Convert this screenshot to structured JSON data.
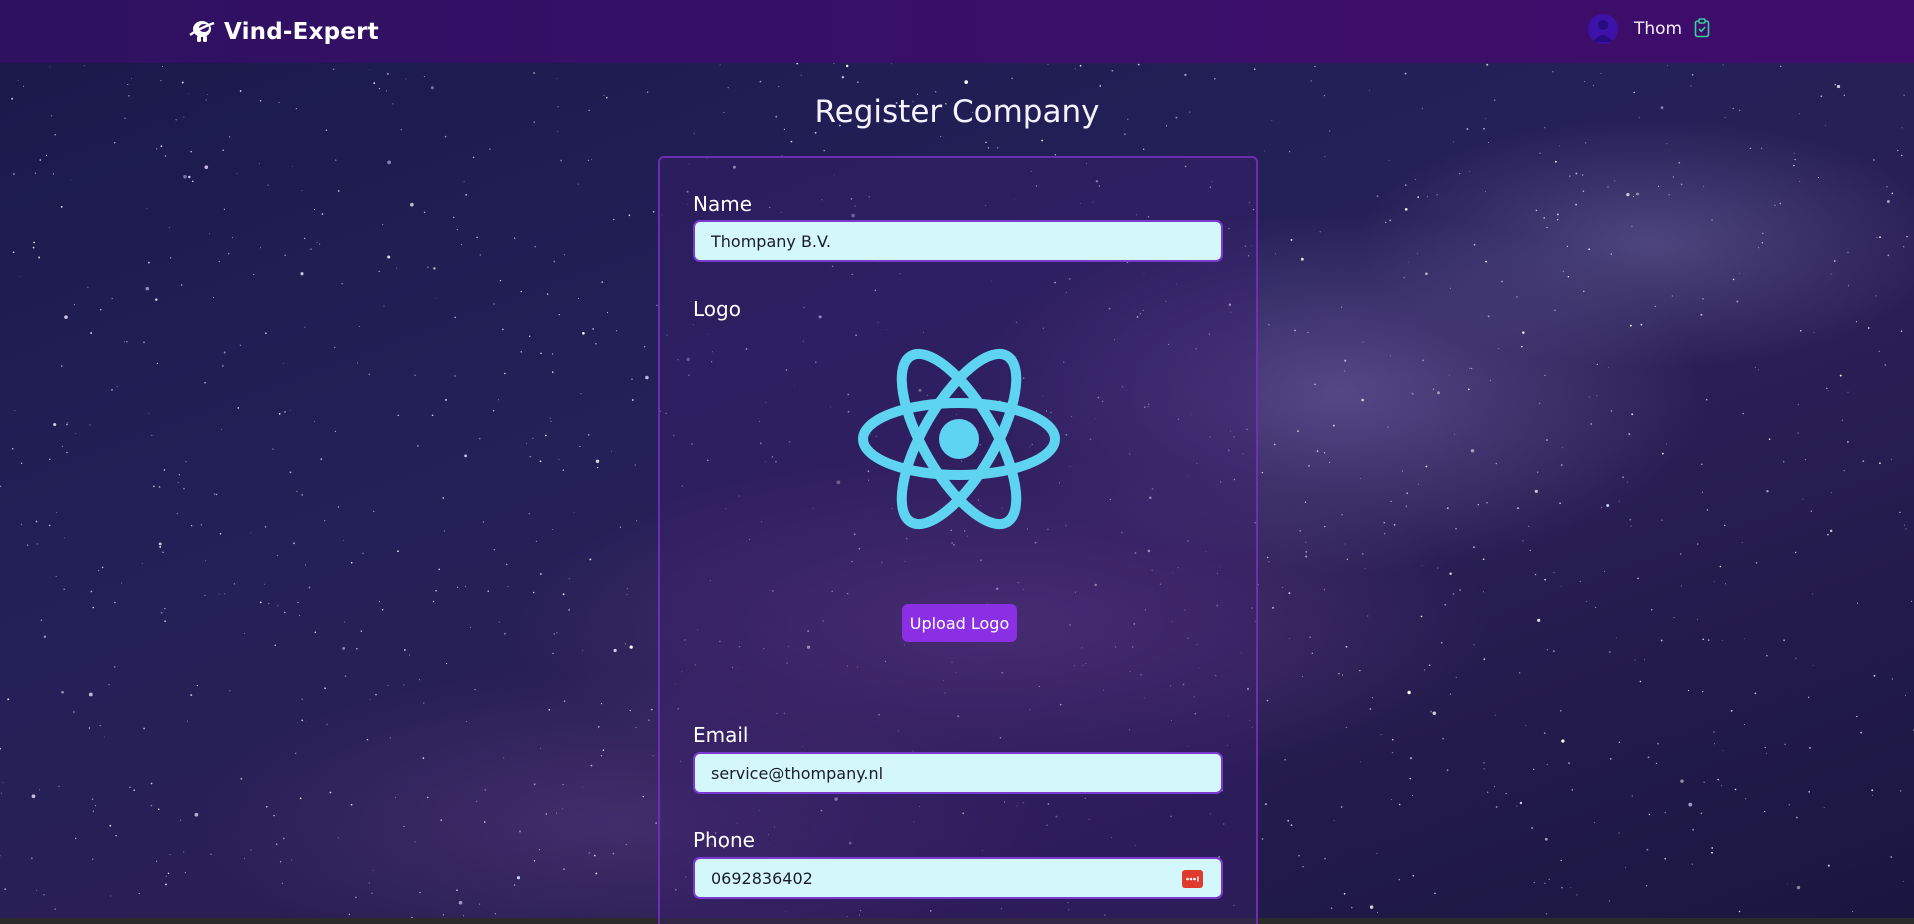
{
  "header": {
    "brand": "Vind-Expert",
    "user_name": "Thom",
    "icons": [
      "astronaut-logo-icon",
      "user-avatar-icon",
      "clipboard-check-icon"
    ],
    "bar_color": "#3a0f6a"
  },
  "page": {
    "title": "Register Company"
  },
  "form": {
    "name_label": "Name",
    "name_value": "Thompany B.V.",
    "logo_label": "Logo",
    "logo_icon": "atom-logo-icon",
    "upload_label": "Upload Logo",
    "email_label": "Email",
    "email_value": "service@thompany.nl",
    "phone_label": "Phone",
    "phone_value": "0692836402",
    "phone_field_icon": "password-manager-icon"
  },
  "colors": {
    "accent": "#8b2fe4",
    "input_bg": "#d3f7fb",
    "logo_color": "#5ed4f0"
  }
}
